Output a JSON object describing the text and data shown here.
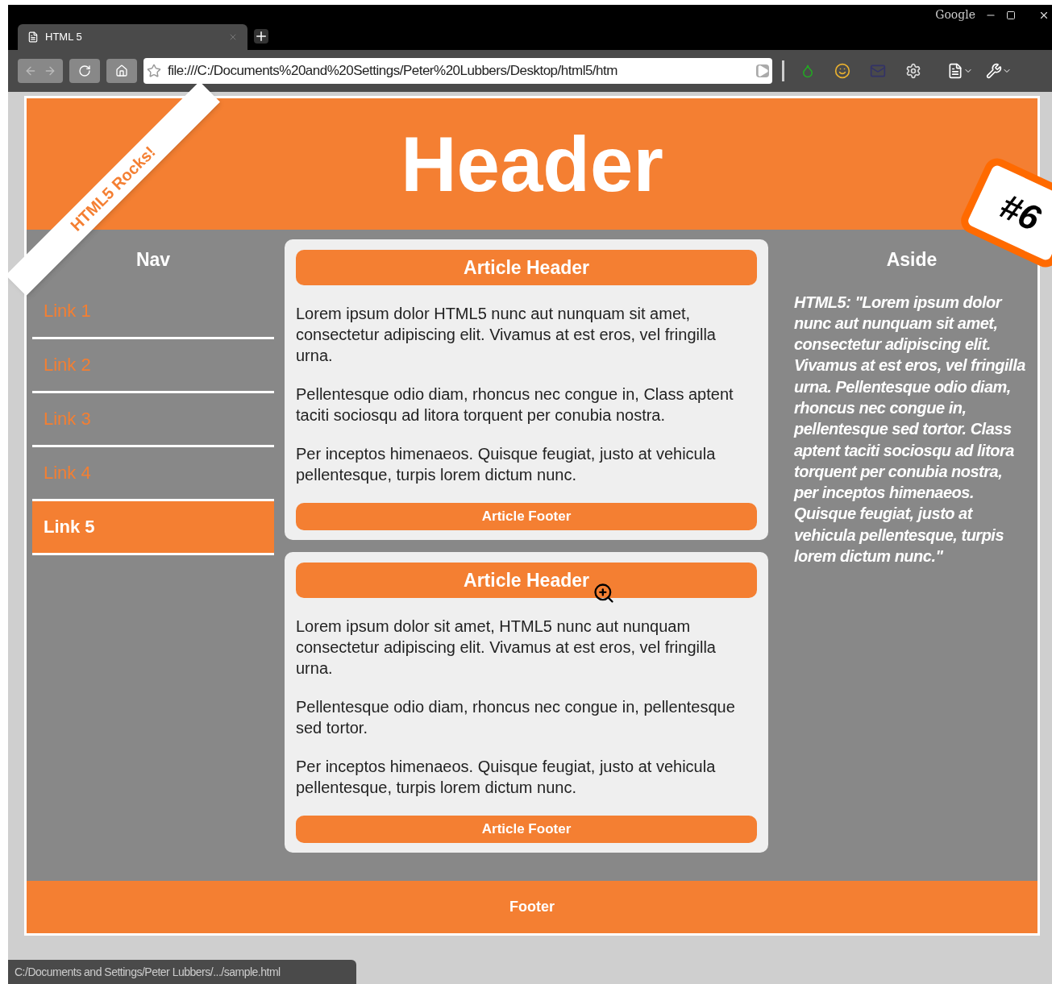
{
  "browser": {
    "tab_title": "HTML 5",
    "brand": "Google",
    "address": "file:///C:/Documents%20and%20Settings/Peter%20Lubbers/Desktop/html5/htm",
    "status": "C:/Documents and Settings/Peter Lubbers/.../sample.html"
  },
  "page": {
    "header": "Header",
    "ribbon": "HTML5 Rocks!",
    "badge": "#6",
    "nav": {
      "title": "Nav",
      "links": [
        {
          "label": "Link 1",
          "selected": false
        },
        {
          "label": "Link 2",
          "selected": false
        },
        {
          "label": "Link 3",
          "selected": false
        },
        {
          "label": "Link 4",
          "selected": false
        },
        {
          "label": "Link 5",
          "selected": true
        }
      ]
    },
    "articles": [
      {
        "header": "Article Header",
        "paragraphs": [
          "Lorem ipsum dolor HTML5 nunc aut nunquam sit amet, consectetur adipiscing elit. Vivamus at est eros, vel fringilla urna.",
          "Pellentesque odio diam, rhoncus nec congue in, Class aptent taciti sociosqu ad litora torquent per conubia nostra.",
          "Per inceptos himenaeos. Quisque feugiat, justo at vehicula pellentesque, turpis lorem dictum nunc."
        ],
        "footer": "Article Footer"
      },
      {
        "header": "Article Header",
        "paragraphs": [
          "Lorem ipsum dolor sit amet, HTML5 nunc aut nunquam consectetur adipiscing elit. Vivamus at est eros, vel fringilla urna.",
          "Pellentesque odio diam, rhoncus nec congue in, pellentesque sed tortor.",
          "Per inceptos himenaeos. Quisque feugiat, justo at vehicula pellentesque, turpis lorem dictum nunc."
        ],
        "footer": "Article Footer"
      }
    ],
    "aside": {
      "title": "Aside",
      "text": "HTML5: \"Lorem ipsum dolor nunc aut nunquam sit amet, consectetur adipiscing elit. Vivamus at est eros, vel fringilla urna. Pellentesque odio diam, rhoncus nec congue in, pellentesque sed tortor. Class aptent taciti sociosqu ad litora torquent per conubia nostra, per inceptos himenaeos. Quisque feugiat, justo at vehicula pellentesque, turpis lorem dictum nunc.\""
    },
    "footer": "Footer"
  }
}
